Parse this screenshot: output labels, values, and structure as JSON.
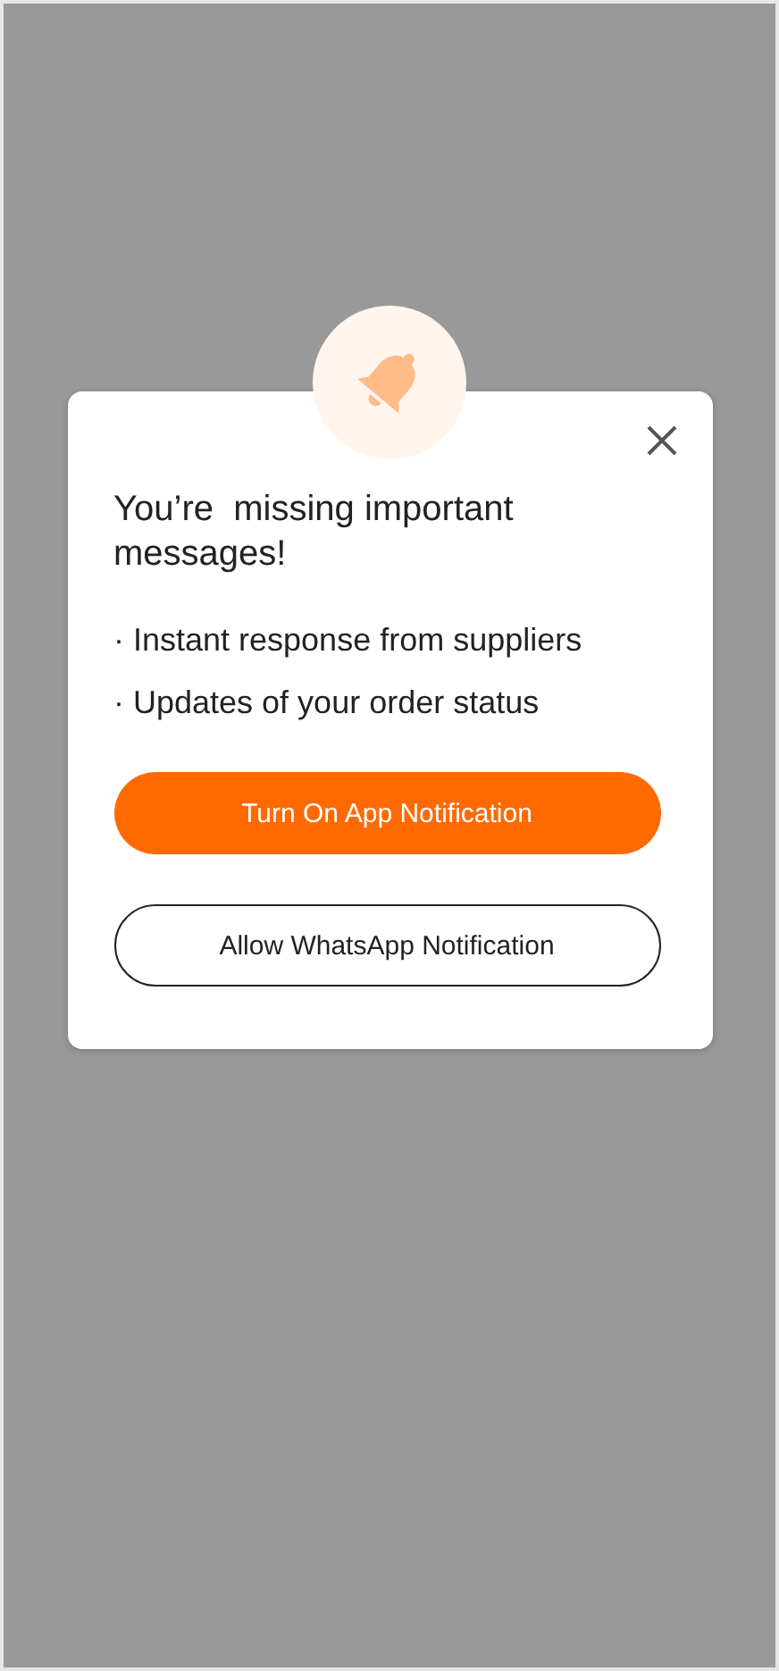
{
  "dialog": {
    "title": "You’re  missing important messages!",
    "bullets": [
      "· Instant response from suppliers",
      "· Updates of your order status"
    ],
    "buttons": [
      {
        "label": "Turn On App Notification",
        "kind": "primary"
      },
      {
        "label": "Allow WhatsApp Notification",
        "kind": "outline"
      }
    ]
  }
}
